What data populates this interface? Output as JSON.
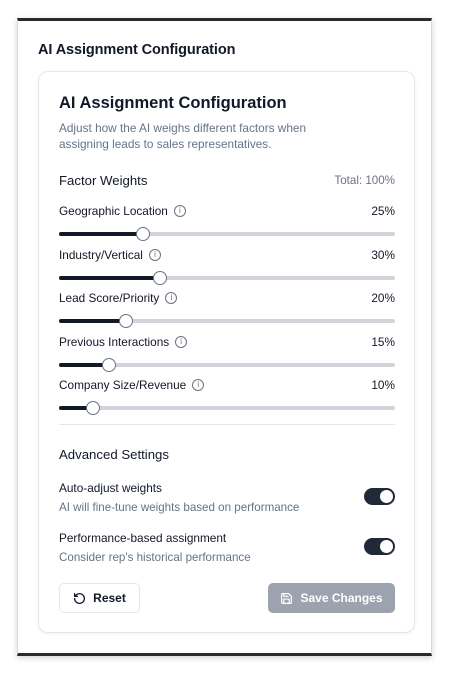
{
  "window": {
    "title": "AI Assignment Configuration"
  },
  "card": {
    "title": "AI Assignment Configuration",
    "description": "Adjust how the AI weighs different factors when assigning leads to sales representatives."
  },
  "factor_weights": {
    "title": "Factor Weights",
    "total": "Total: 100%",
    "items": [
      {
        "label": "Geographic Location",
        "value_label": "25%",
        "value": 0.25,
        "icon": "info-icon"
      },
      {
        "label": "Industry/Vertical",
        "value_label": "30%",
        "value": 0.3,
        "icon": "info-icon"
      },
      {
        "label": "Lead Score/Priority",
        "value_label": "20%",
        "value": 0.2,
        "icon": "info-icon"
      },
      {
        "label": "Previous Interactions",
        "value_label": "15%",
        "value": 0.15,
        "icon": "info-icon"
      },
      {
        "label": "Company Size/Revenue",
        "value_label": "10%",
        "value": 0.1,
        "icon": "info-icon"
      }
    ]
  },
  "advanced": {
    "title": "Advanced Settings",
    "settings": [
      {
        "name": "Auto-adjust weights",
        "description": "AI will fine-tune weights based on performance",
        "enabled": true
      },
      {
        "name": "Performance-based assignment",
        "description": "Consider rep's historical performance",
        "enabled": true
      }
    ]
  },
  "actions": {
    "reset_label": "Reset",
    "reset_icon": "rotate-ccw-icon",
    "save_label": "Save Changes",
    "save_icon": "floppy-disk-icon"
  },
  "colors": {
    "accent": "#111827",
    "track": "#d1d5db",
    "muted_text": "#64748b",
    "save_disabled": "#9ca3af"
  }
}
